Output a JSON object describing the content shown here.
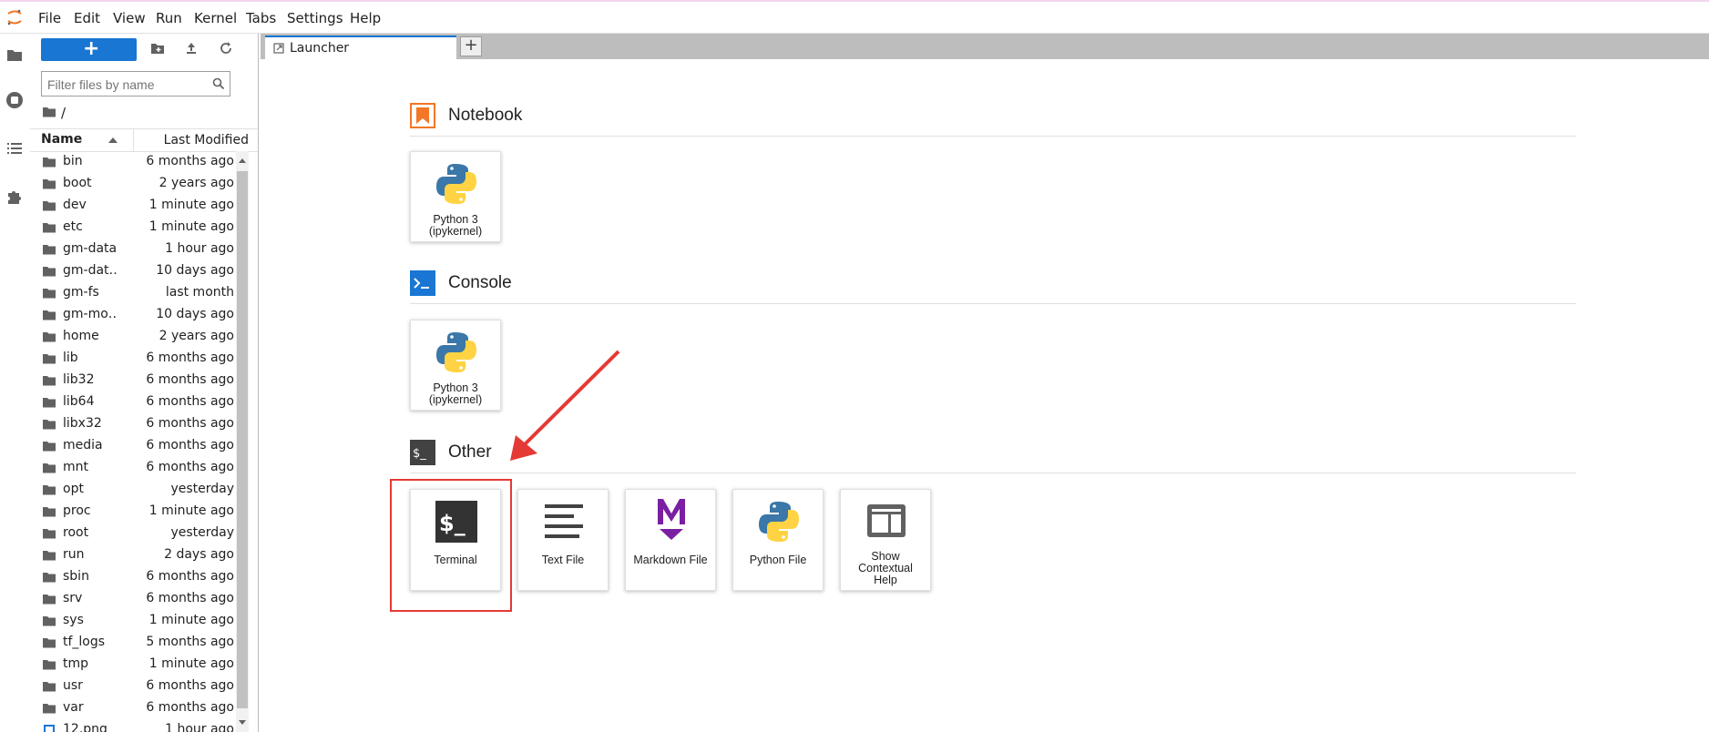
{
  "menu": [
    "File",
    "Edit",
    "View",
    "Run",
    "Kernel",
    "Tabs",
    "Settings",
    "Help"
  ],
  "filebrowser": {
    "new_label": "+",
    "filter_placeholder": "Filter files by name",
    "breadcrumb": "/",
    "col_name": "Name",
    "col_modified": "Last Modified",
    "rows": [
      {
        "name": "bin",
        "modified": "6 months ago"
      },
      {
        "name": "boot",
        "modified": "2 years ago"
      },
      {
        "name": "dev",
        "modified": "1 minute ago"
      },
      {
        "name": "etc",
        "modified": "1 minute ago"
      },
      {
        "name": "gm-data",
        "modified": "1 hour ago"
      },
      {
        "name": "gm-dat…",
        "modified": "10 days ago"
      },
      {
        "name": "gm-fs",
        "modified": "last month"
      },
      {
        "name": "gm-mo…",
        "modified": "10 days ago"
      },
      {
        "name": "home",
        "modified": "2 years ago"
      },
      {
        "name": "lib",
        "modified": "6 months ago"
      },
      {
        "name": "lib32",
        "modified": "6 months ago"
      },
      {
        "name": "lib64",
        "modified": "6 months ago"
      },
      {
        "name": "libx32",
        "modified": "6 months ago"
      },
      {
        "name": "media",
        "modified": "6 months ago"
      },
      {
        "name": "mnt",
        "modified": "6 months ago"
      },
      {
        "name": "opt",
        "modified": "yesterday"
      },
      {
        "name": "proc",
        "modified": "1 minute ago"
      },
      {
        "name": "root",
        "modified": "yesterday"
      },
      {
        "name": "run",
        "modified": "2 days ago"
      },
      {
        "name": "sbin",
        "modified": "6 months ago"
      },
      {
        "name": "srv",
        "modified": "6 months ago"
      },
      {
        "name": "sys",
        "modified": "1 minute ago"
      },
      {
        "name": "tf_logs",
        "modified": "5 months ago"
      },
      {
        "name": "tmp",
        "modified": "1 minute ago"
      },
      {
        "name": "usr",
        "modified": "6 months ago"
      },
      {
        "name": "var",
        "modified": "6 months ago"
      },
      {
        "name": "12.png",
        "modified": "1 hour ago"
      }
    ]
  },
  "tabs": {
    "launcher_label": "Launcher",
    "add_label": "+"
  },
  "launcher": {
    "notebook_title": "Notebook",
    "console_title": "Console",
    "other_title": "Other",
    "notebook_card": {
      "line1": "Python 3",
      "line2": "(ipykernel)"
    },
    "console_card": {
      "line1": "Python 3",
      "line2": "(ipykernel)"
    },
    "other_cards": {
      "terminal": "Terminal",
      "textfile": "Text File",
      "markdown": "Markdown File",
      "pythonfile": "Python File",
      "help_line1": "Show",
      "help_line2": "Contextual",
      "help_line3": "Help"
    }
  },
  "colors": {
    "accent": "#1976d2",
    "notebook": "#f37726",
    "annotation": "#e53935",
    "markdown": "#7b1fa2"
  },
  "icons": [
    "jupyter-logo-icon",
    "folder-icon",
    "stop-circle-icon",
    "list-icon",
    "puzzle-icon",
    "new-folder-icon",
    "upload-icon",
    "refresh-icon",
    "search-icon",
    "python-icon",
    "terminal-icon",
    "text-file-icon",
    "markdown-icon",
    "contextual-help-icon"
  ]
}
